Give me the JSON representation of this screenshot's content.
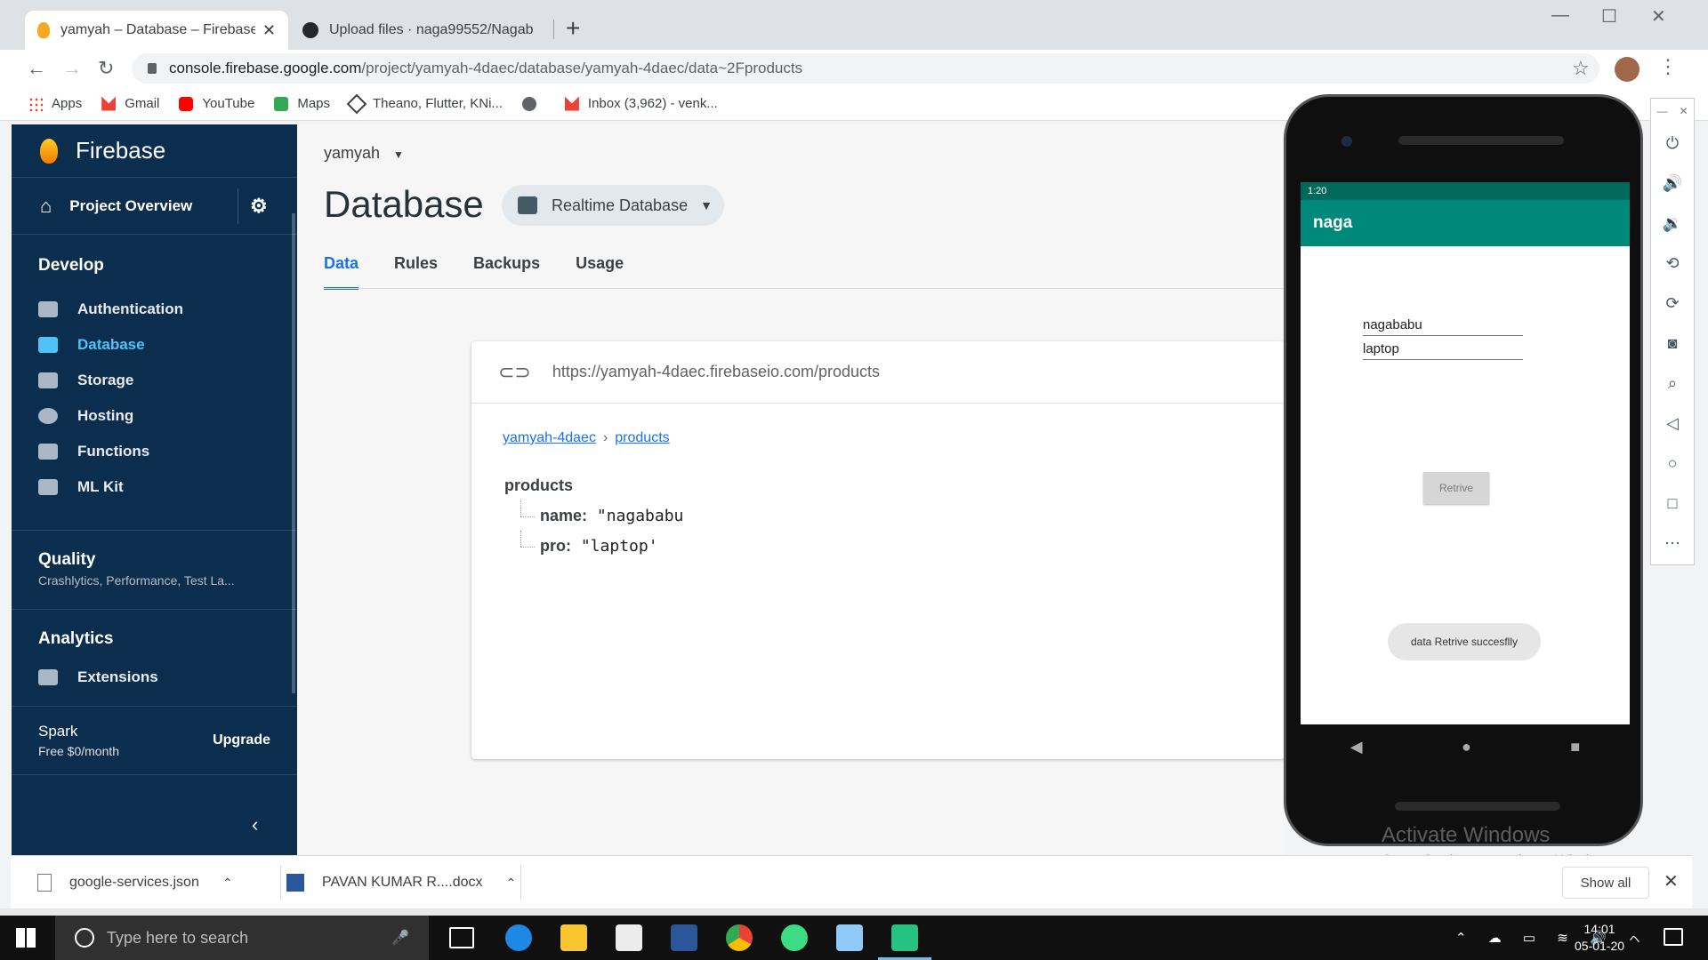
{
  "browser": {
    "tabs": [
      {
        "title": "yamyah – Database – Firebase co",
        "icon": "firebase-favicon-icon"
      },
      {
        "title": "Upload files · naga99552/Nagab",
        "icon": "github-favicon-icon"
      }
    ],
    "url_host": "console.firebase.google.com",
    "url_path": "/project/yamyah-4daec/database/yamyah-4daec/data~2Fproducts",
    "bookmarks": [
      {
        "label": "Apps",
        "icon": "apps-grid-icon"
      },
      {
        "label": "Gmail",
        "icon": "gmail-icon"
      },
      {
        "label": "YouTube",
        "icon": "youtube-icon"
      },
      {
        "label": "Maps",
        "icon": "maps-icon"
      },
      {
        "label": "Theano, Flutter, KNi...",
        "icon": "diamond-icon"
      },
      {
        "label": "",
        "icon": "globe-icon"
      },
      {
        "label": "Inbox (3,962) - venk...",
        "icon": "gmail-icon"
      }
    ]
  },
  "sidebar": {
    "brand": "Firebase",
    "project_overview": "Project Overview",
    "develop_title": "Develop",
    "develop_items": [
      {
        "label": "Authentication",
        "icon": "people-icon"
      },
      {
        "label": "Database",
        "icon": "database-icon"
      },
      {
        "label": "Storage",
        "icon": "storage-icon"
      },
      {
        "label": "Hosting",
        "icon": "globe-icon"
      },
      {
        "label": "Functions",
        "icon": "functions-icon"
      },
      {
        "label": "ML Kit",
        "icon": "ml-kit-icon"
      }
    ],
    "quality_title": "Quality",
    "quality_sub": "Crashlytics, Performance, Test La...",
    "analytics_title": "Analytics",
    "extensions": "Extensions",
    "plan": "Spark",
    "price": "Free $0/month",
    "upgrade": "Upgrade"
  },
  "main": {
    "project_name": "yamyah",
    "title": "Database",
    "db_selector": "Realtime Database",
    "tabs": [
      "Data",
      "Rules",
      "Backups",
      "Usage"
    ],
    "db_url": "https://yamyah-4daec.firebaseio.com/products",
    "breadcrumb": [
      "yamyah-4daec",
      "products"
    ],
    "tree_root": "products",
    "tree_entries": [
      {
        "key": "name:",
        "value": "\"nagababu"
      },
      {
        "key": "pro:",
        "value": "\"laptop'"
      }
    ]
  },
  "emulator": {
    "status_time": "1:20",
    "app_title": "naga",
    "field_name": "nagababu",
    "field_product": "laptop",
    "button_label": "Retrive",
    "toast": "data Retrive  succesflly"
  },
  "watermark": {
    "line1": "Activate Windows",
    "line2": "Go to Settings to activate Windows."
  },
  "downloads": {
    "items": [
      "google-services.json",
      "PAVAN KUMAR R....docx"
    ],
    "show_all": "Show all"
  },
  "taskbar": {
    "search_placeholder": "Type here to search",
    "time": "14:01",
    "date": "05-01-20"
  }
}
